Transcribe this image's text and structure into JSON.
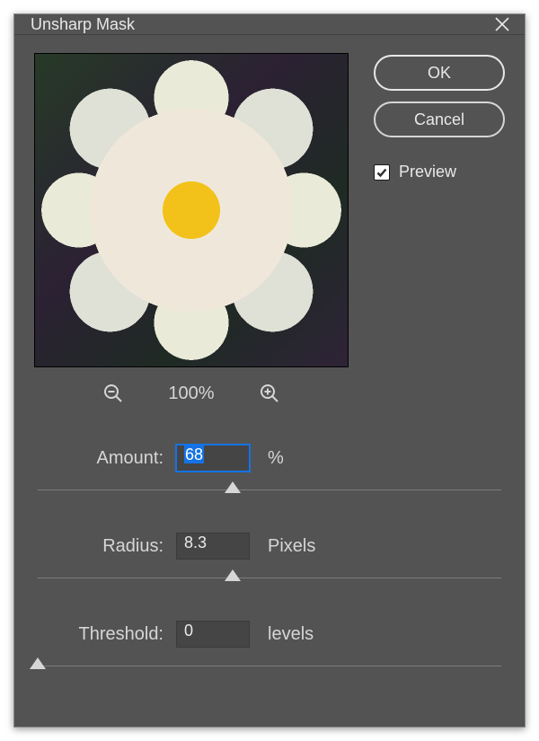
{
  "dialog": {
    "title": "Unsharp Mask"
  },
  "buttons": {
    "ok": "OK",
    "cancel": "Cancel"
  },
  "preview": {
    "checkbox_label": "Preview",
    "checked": true,
    "zoom_level": "100%"
  },
  "params": {
    "amount": {
      "label": "Amount:",
      "value": "68",
      "unit": "%",
      "slider_percent": 42
    },
    "radius": {
      "label": "Radius:",
      "value": "8.3",
      "unit": "Pixels",
      "slider_percent": 42
    },
    "threshold": {
      "label": "Threshold:",
      "value": "0",
      "unit": "levels",
      "slider_percent": 0
    }
  }
}
